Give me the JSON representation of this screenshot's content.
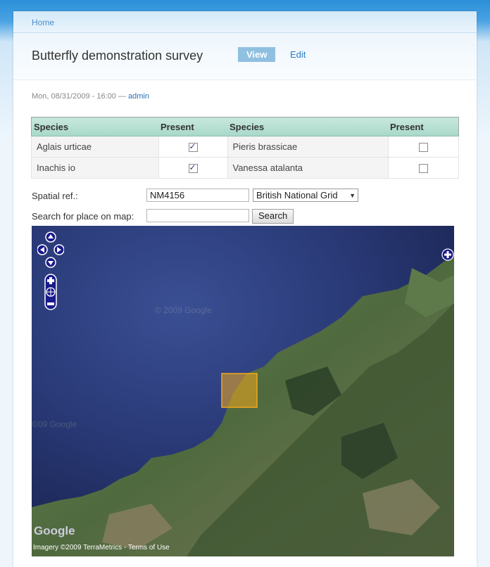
{
  "breadcrumb": {
    "home": "Home"
  },
  "page": {
    "title": "Butterfly demonstration survey",
    "tabs": [
      {
        "label": "View",
        "active": true
      },
      {
        "label": "Edit",
        "active": false
      }
    ],
    "submitted": {
      "date": "Mon, 08/31/2009 - 16:00 — ",
      "author": "admin"
    }
  },
  "species_table": {
    "headers": [
      "Species",
      "Present",
      "Species",
      "Present"
    ],
    "rows": [
      {
        "left": "Aglais urticae",
        "left_present": true,
        "right": "Pieris brassicae",
        "right_present": false
      },
      {
        "left": "Inachis io",
        "left_present": true,
        "right": "Vanessa atalanta",
        "right_present": false
      }
    ]
  },
  "form": {
    "spatial_ref_label": "Spatial ref.:",
    "spatial_ref_value": "NM4156",
    "grid_system": "British National Grid",
    "search_label": "Search for place on map:",
    "search_value": "",
    "search_button": "Search"
  },
  "map": {
    "watermark_1": "© 2009 Google",
    "watermark_2": "©09 Google",
    "logo": "Google",
    "attribution": "Imagery ©2009 TerraMetrics - Terms of Use",
    "highlight_color": "#f2a81d"
  }
}
